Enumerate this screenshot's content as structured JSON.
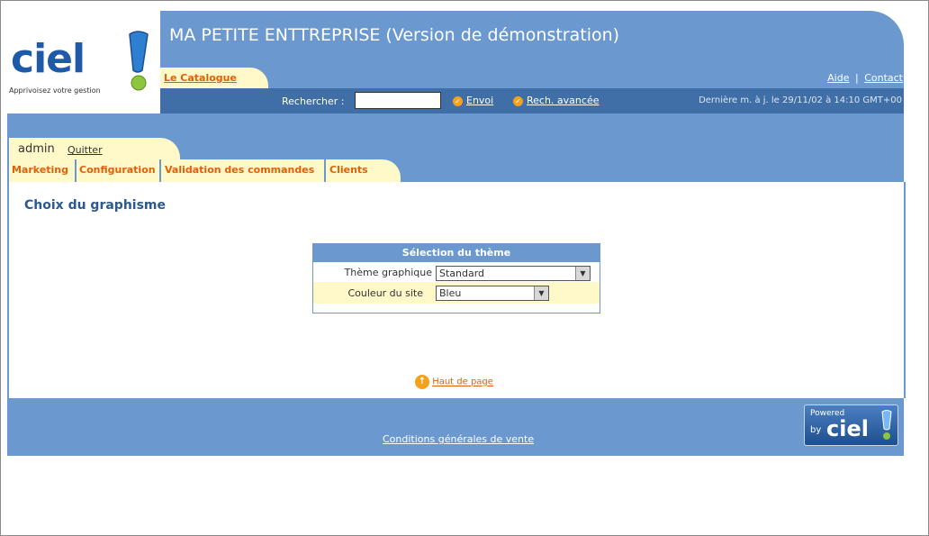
{
  "header": {
    "app_title": "MA PETITE ENTTREPRISE (Version de démonstration)",
    "logo_text": "ciel",
    "tagline": "Apprivoisez votre gestion",
    "catalogue_tab": "Le Catalogue",
    "help_link": "Aide",
    "separator": "|",
    "contact_link": "Contact",
    "search_label": "Rechercher :",
    "search_value": "",
    "send_link": "Envoi",
    "advanced_search_link": "Rech. avancée",
    "last_update": "Dernière m. à j. le 29/11/02 à 14:10 GMT+00"
  },
  "user": {
    "name": "admin",
    "logout": "Quitter"
  },
  "nav": {
    "tabs": [
      "Marketing",
      "Configuration",
      "Validation des commandes",
      "Clients"
    ]
  },
  "main": {
    "title": "Choix du graphisme",
    "theme_box": {
      "header": "Sélection du thème",
      "theme_label": "Thème graphique",
      "theme_value": "Standard",
      "color_label": "Couleur du site",
      "color_value": "Bleu"
    },
    "back_to_top": "Haut de page"
  },
  "footer": {
    "terms_link": "Conditions générales de vente",
    "powered_by": "Powered",
    "by": "by",
    "brand": "ciel"
  },
  "colors": {
    "header_blue": "#6a98cf",
    "band_blue": "#3f6fa6",
    "tab_yellow": "#fff8c8",
    "accent_orange": "#e0600a",
    "title_blue": "#2c5a8c"
  }
}
